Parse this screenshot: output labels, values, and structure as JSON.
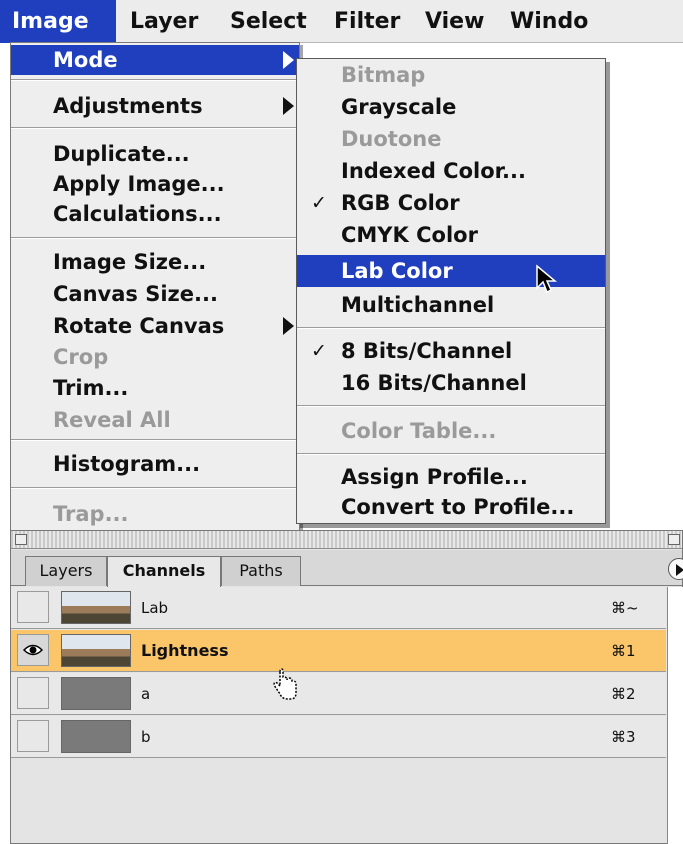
{
  "menubar": {
    "items": [
      "Image",
      "Layer",
      "Select",
      "Filter",
      "View",
      "Windo"
    ]
  },
  "image_menu": {
    "mode": "Mode",
    "adjustments": "Adjustments",
    "duplicate": "Duplicate...",
    "apply_image": "Apply Image...",
    "calculations": "Calculations...",
    "image_size": "Image Size...",
    "canvas_size": "Canvas Size...",
    "rotate_canvas": "Rotate Canvas",
    "crop": "Crop",
    "trim": "Trim...",
    "reveal_all": "Reveal All",
    "histogram": "Histogram...",
    "trap": "Trap..."
  },
  "mode_submenu": {
    "bitmap": "Bitmap",
    "grayscale": "Grayscale",
    "duotone": "Duotone",
    "indexed_color": "Indexed Color...",
    "rgb_color": "RGB Color",
    "cmyk_color": "CMYK Color",
    "lab_color": "Lab Color",
    "multichannel": "Multichannel",
    "bits8": "8 Bits/Channel",
    "bits16": "16 Bits/Channel",
    "color_table": "Color Table...",
    "assign_profile": "Assign Profile...",
    "convert_profile": "Convert to Profile...",
    "check": "✓"
  },
  "palette": {
    "tabs": [
      "Layers",
      "Channels",
      "Paths"
    ],
    "channels": [
      {
        "name": "Lab",
        "shortcut": "⌘~"
      },
      {
        "name": "Lightness",
        "shortcut": "⌘1"
      },
      {
        "name": "a",
        "shortcut": "⌘2"
      },
      {
        "name": "b",
        "shortcut": "⌘3"
      }
    ],
    "selected_color": "#fbc56a"
  },
  "colors": {
    "highlight": "#1f3fbf"
  }
}
